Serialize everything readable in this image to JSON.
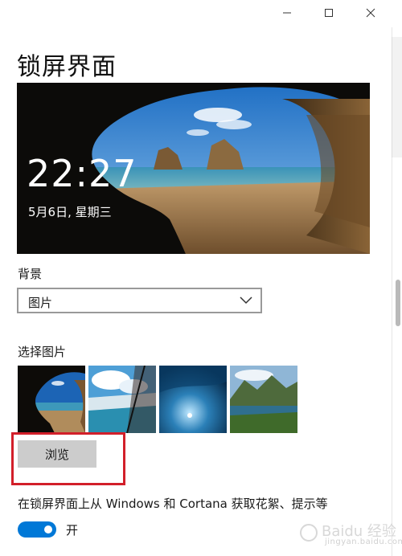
{
  "window": {
    "controls": [
      "minimize",
      "maximize",
      "close"
    ]
  },
  "page": {
    "title": "锁屏界面"
  },
  "preview": {
    "time": "22:27",
    "date": "5月6日, 星期三"
  },
  "background": {
    "label": "背景",
    "selected": "图片"
  },
  "choose_picture": {
    "label": "选择图片",
    "thumbnails": [
      "cave-beach",
      "snow-window",
      "ice-cave",
      "mountain-lake"
    ]
  },
  "browse_button": {
    "label": "浏览"
  },
  "spotlight": {
    "text": "在锁屏界面上从 Windows 和 Cortana 获取花絮、提示等",
    "toggle_state": "开",
    "toggle_on": true
  },
  "colors": {
    "accent": "#0078d7",
    "highlight_box": "#d21f2a",
    "button_bg": "#cccccc"
  },
  "watermark": {
    "text": "jingyan.baidu.com"
  }
}
